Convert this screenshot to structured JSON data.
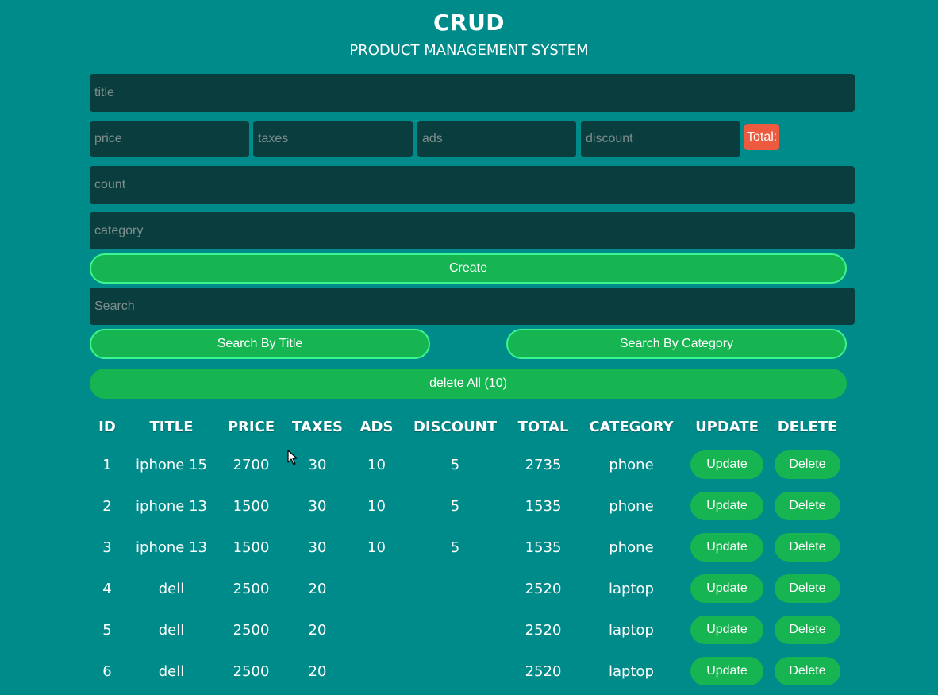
{
  "header": {
    "title": "CRUD",
    "subtitle": "PRODUCT MANAGEMENT SYSTEM"
  },
  "form": {
    "title_placeholder": "title",
    "price_placeholder": "price",
    "taxes_placeholder": "taxes",
    "ads_placeholder": "ads",
    "discount_placeholder": "discount",
    "total_label": "Total:",
    "total_color": "#ee5a3f",
    "count_placeholder": "count",
    "category_placeholder": "category",
    "create_label": "Create"
  },
  "search": {
    "placeholder": "Search",
    "by_title_label": "Search By Title",
    "by_category_label": "Search By Category"
  },
  "delete_all_label": "delete All (10)",
  "table": {
    "headers": [
      "ID",
      "TITLE",
      "PRICE",
      "TAXES",
      "ADS",
      "DISCOUNT",
      "TOTAL",
      "CATEGORY",
      "UPDATE",
      "DELETE"
    ],
    "update_label": "Update",
    "delete_label": "Delete",
    "rows": [
      {
        "id": "1",
        "title": "iphone 15",
        "price": "2700",
        "taxes": "30",
        "ads": "10",
        "discount": "5",
        "total": "2735",
        "category": "phone"
      },
      {
        "id": "2",
        "title": "iphone 13",
        "price": "1500",
        "taxes": "30",
        "ads": "10",
        "discount": "5",
        "total": "1535",
        "category": "phone"
      },
      {
        "id": "3",
        "title": "iphone 13",
        "price": "1500",
        "taxes": "30",
        "ads": "10",
        "discount": "5",
        "total": "1535",
        "category": "phone"
      },
      {
        "id": "4",
        "title": "dell",
        "price": "2500",
        "taxes": "20",
        "ads": "",
        "discount": "",
        "total": "2520",
        "category": "laptop"
      },
      {
        "id": "5",
        "title": "dell",
        "price": "2500",
        "taxes": "20",
        "ads": "",
        "discount": "",
        "total": "2520",
        "category": "laptop"
      },
      {
        "id": "6",
        "title": "dell",
        "price": "2500",
        "taxes": "20",
        "ads": "",
        "discount": "",
        "total": "2520",
        "category": "laptop"
      }
    ]
  },
  "colors": {
    "background": "#008b8b",
    "input_background": "#0a3d3d",
    "button_green": "#16b551",
    "button_border": "#3bf58e"
  },
  "icons": {
    "cursor": "mouse-pointer-icon"
  }
}
